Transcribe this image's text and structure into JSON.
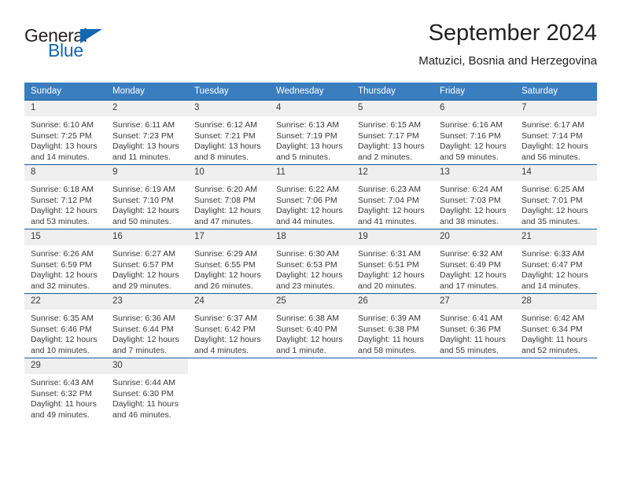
{
  "brand": {
    "name_part1": "General",
    "name_part2": "Blue",
    "accent_color": "#1267b1"
  },
  "header": {
    "title": "September 2024",
    "subtitle": "Matuzici, Bosnia and Herzegovina"
  },
  "theme": {
    "header_row_bg": "#3a7ec0",
    "cell_divider": "#1a5a9e",
    "day_number_bg": "#efefef",
    "text_color": "#3a3a3a"
  },
  "calendar": {
    "weekday_headers": [
      "Sunday",
      "Monday",
      "Tuesday",
      "Wednesday",
      "Thursday",
      "Friday",
      "Saturday"
    ],
    "weeks": [
      [
        {
          "day": "1",
          "sunrise": "Sunrise: 6:10 AM",
          "sunset": "Sunset: 7:25 PM",
          "daylight1": "Daylight: 13 hours",
          "daylight2": "and 14 minutes."
        },
        {
          "day": "2",
          "sunrise": "Sunrise: 6:11 AM",
          "sunset": "Sunset: 7:23 PM",
          "daylight1": "Daylight: 13 hours",
          "daylight2": "and 11 minutes."
        },
        {
          "day": "3",
          "sunrise": "Sunrise: 6:12 AM",
          "sunset": "Sunset: 7:21 PM",
          "daylight1": "Daylight: 13 hours",
          "daylight2": "and 8 minutes."
        },
        {
          "day": "4",
          "sunrise": "Sunrise: 6:13 AM",
          "sunset": "Sunset: 7:19 PM",
          "daylight1": "Daylight: 13 hours",
          "daylight2": "and 5 minutes."
        },
        {
          "day": "5",
          "sunrise": "Sunrise: 6:15 AM",
          "sunset": "Sunset: 7:17 PM",
          "daylight1": "Daylight: 13 hours",
          "daylight2": "and 2 minutes."
        },
        {
          "day": "6",
          "sunrise": "Sunrise: 6:16 AM",
          "sunset": "Sunset: 7:16 PM",
          "daylight1": "Daylight: 12 hours",
          "daylight2": "and 59 minutes."
        },
        {
          "day": "7",
          "sunrise": "Sunrise: 6:17 AM",
          "sunset": "Sunset: 7:14 PM",
          "daylight1": "Daylight: 12 hours",
          "daylight2": "and 56 minutes."
        }
      ],
      [
        {
          "day": "8",
          "sunrise": "Sunrise: 6:18 AM",
          "sunset": "Sunset: 7:12 PM",
          "daylight1": "Daylight: 12 hours",
          "daylight2": "and 53 minutes."
        },
        {
          "day": "9",
          "sunrise": "Sunrise: 6:19 AM",
          "sunset": "Sunset: 7:10 PM",
          "daylight1": "Daylight: 12 hours",
          "daylight2": "and 50 minutes."
        },
        {
          "day": "10",
          "sunrise": "Sunrise: 6:20 AM",
          "sunset": "Sunset: 7:08 PM",
          "daylight1": "Daylight: 12 hours",
          "daylight2": "and 47 minutes."
        },
        {
          "day": "11",
          "sunrise": "Sunrise: 6:22 AM",
          "sunset": "Sunset: 7:06 PM",
          "daylight1": "Daylight: 12 hours",
          "daylight2": "and 44 minutes."
        },
        {
          "day": "12",
          "sunrise": "Sunrise: 6:23 AM",
          "sunset": "Sunset: 7:04 PM",
          "daylight1": "Daylight: 12 hours",
          "daylight2": "and 41 minutes."
        },
        {
          "day": "13",
          "sunrise": "Sunrise: 6:24 AM",
          "sunset": "Sunset: 7:03 PM",
          "daylight1": "Daylight: 12 hours",
          "daylight2": "and 38 minutes."
        },
        {
          "day": "14",
          "sunrise": "Sunrise: 6:25 AM",
          "sunset": "Sunset: 7:01 PM",
          "daylight1": "Daylight: 12 hours",
          "daylight2": "and 35 minutes."
        }
      ],
      [
        {
          "day": "15",
          "sunrise": "Sunrise: 6:26 AM",
          "sunset": "Sunset: 6:59 PM",
          "daylight1": "Daylight: 12 hours",
          "daylight2": "and 32 minutes."
        },
        {
          "day": "16",
          "sunrise": "Sunrise: 6:27 AM",
          "sunset": "Sunset: 6:57 PM",
          "daylight1": "Daylight: 12 hours",
          "daylight2": "and 29 minutes."
        },
        {
          "day": "17",
          "sunrise": "Sunrise: 6:29 AM",
          "sunset": "Sunset: 6:55 PM",
          "daylight1": "Daylight: 12 hours",
          "daylight2": "and 26 minutes."
        },
        {
          "day": "18",
          "sunrise": "Sunrise: 6:30 AM",
          "sunset": "Sunset: 6:53 PM",
          "daylight1": "Daylight: 12 hours",
          "daylight2": "and 23 minutes."
        },
        {
          "day": "19",
          "sunrise": "Sunrise: 6:31 AM",
          "sunset": "Sunset: 6:51 PM",
          "daylight1": "Daylight: 12 hours",
          "daylight2": "and 20 minutes."
        },
        {
          "day": "20",
          "sunrise": "Sunrise: 6:32 AM",
          "sunset": "Sunset: 6:49 PM",
          "daylight1": "Daylight: 12 hours",
          "daylight2": "and 17 minutes."
        },
        {
          "day": "21",
          "sunrise": "Sunrise: 6:33 AM",
          "sunset": "Sunset: 6:47 PM",
          "daylight1": "Daylight: 12 hours",
          "daylight2": "and 14 minutes."
        }
      ],
      [
        {
          "day": "22",
          "sunrise": "Sunrise: 6:35 AM",
          "sunset": "Sunset: 6:46 PM",
          "daylight1": "Daylight: 12 hours",
          "daylight2": "and 10 minutes."
        },
        {
          "day": "23",
          "sunrise": "Sunrise: 6:36 AM",
          "sunset": "Sunset: 6:44 PM",
          "daylight1": "Daylight: 12 hours",
          "daylight2": "and 7 minutes."
        },
        {
          "day": "24",
          "sunrise": "Sunrise: 6:37 AM",
          "sunset": "Sunset: 6:42 PM",
          "daylight1": "Daylight: 12 hours",
          "daylight2": "and 4 minutes."
        },
        {
          "day": "25",
          "sunrise": "Sunrise: 6:38 AM",
          "sunset": "Sunset: 6:40 PM",
          "daylight1": "Daylight: 12 hours",
          "daylight2": "and 1 minute."
        },
        {
          "day": "26",
          "sunrise": "Sunrise: 6:39 AM",
          "sunset": "Sunset: 6:38 PM",
          "daylight1": "Daylight: 11 hours",
          "daylight2": "and 58 minutes."
        },
        {
          "day": "27",
          "sunrise": "Sunrise: 6:41 AM",
          "sunset": "Sunset: 6:36 PM",
          "daylight1": "Daylight: 11 hours",
          "daylight2": "and 55 minutes."
        },
        {
          "day": "28",
          "sunrise": "Sunrise: 6:42 AM",
          "sunset": "Sunset: 6:34 PM",
          "daylight1": "Daylight: 11 hours",
          "daylight2": "and 52 minutes."
        }
      ],
      [
        {
          "day": "29",
          "sunrise": "Sunrise: 6:43 AM",
          "sunset": "Sunset: 6:32 PM",
          "daylight1": "Daylight: 11 hours",
          "daylight2": "and 49 minutes."
        },
        {
          "day": "30",
          "sunrise": "Sunrise: 6:44 AM",
          "sunset": "Sunset: 6:30 PM",
          "daylight1": "Daylight: 11 hours",
          "daylight2": "and 46 minutes."
        },
        {
          "day": "",
          "sunrise": "",
          "sunset": "",
          "daylight1": "",
          "daylight2": ""
        },
        {
          "day": "",
          "sunrise": "",
          "sunset": "",
          "daylight1": "",
          "daylight2": ""
        },
        {
          "day": "",
          "sunrise": "",
          "sunset": "",
          "daylight1": "",
          "daylight2": ""
        },
        {
          "day": "",
          "sunrise": "",
          "sunset": "",
          "daylight1": "",
          "daylight2": ""
        },
        {
          "day": "",
          "sunrise": "",
          "sunset": "",
          "daylight1": "",
          "daylight2": ""
        }
      ]
    ]
  }
}
